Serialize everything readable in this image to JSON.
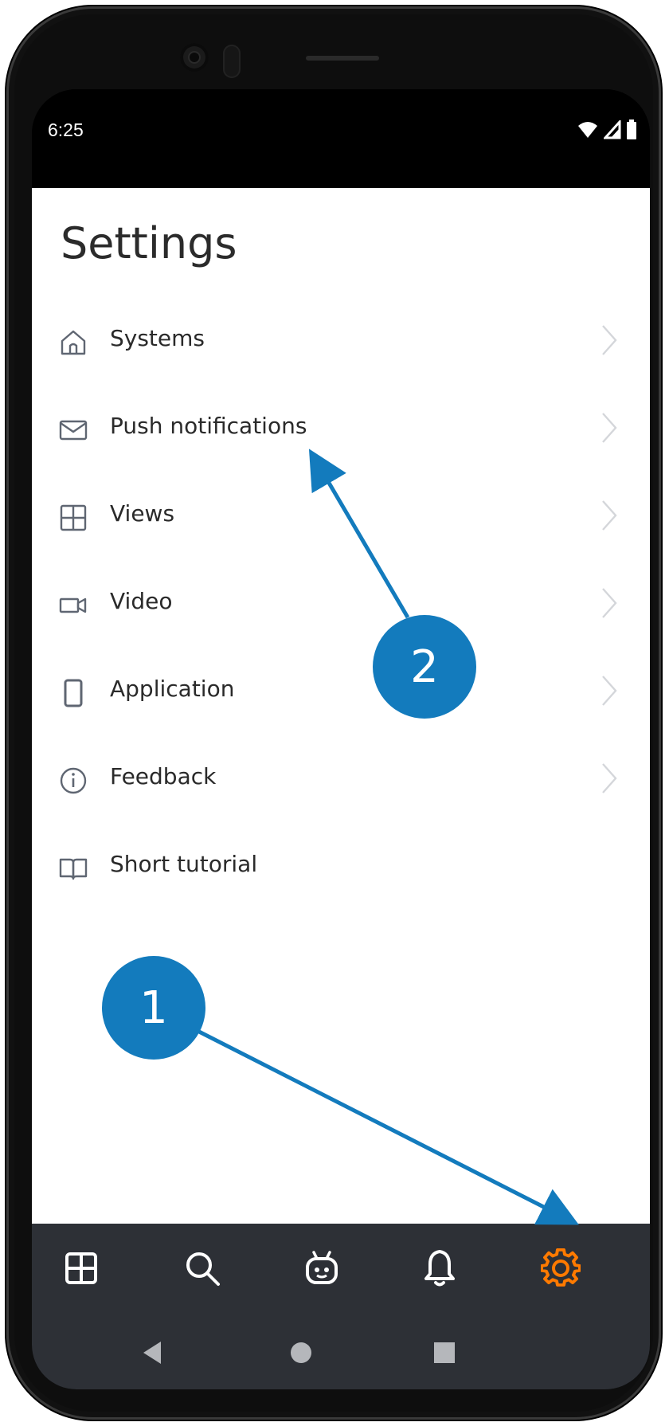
{
  "status_bar": {
    "time": "6:25",
    "icons": [
      "wifi-icon",
      "signal-icon",
      "battery-icon"
    ]
  },
  "page": {
    "title": "Settings"
  },
  "menu": {
    "items": [
      {
        "label": "Systems",
        "icon": "home-icon",
        "chevron": true
      },
      {
        "label": "Push notifications",
        "icon": "mail-icon",
        "chevron": true
      },
      {
        "label": "Views",
        "icon": "grid-icon",
        "chevron": true
      },
      {
        "label": "Video",
        "icon": "video-icon",
        "chevron": true
      },
      {
        "label": "Application",
        "icon": "phone-icon",
        "chevron": true
      },
      {
        "label": "Feedback",
        "icon": "info-icon",
        "chevron": true
      },
      {
        "label": "Short tutorial",
        "icon": "book-icon",
        "chevron": false
      }
    ]
  },
  "bottom_nav": {
    "tabs": [
      "views-tab",
      "search-tab",
      "assistant-tab",
      "notifications-tab",
      "settings-tab"
    ],
    "active_tab": "settings-tab",
    "active_color": "#ff7a00",
    "inactive_color": "#ffffff"
  },
  "system_nav": [
    "back-button",
    "home-button",
    "recents-button"
  ],
  "annotations": {
    "callout_1": "1",
    "callout_2": "2",
    "color": "#137bbd"
  }
}
